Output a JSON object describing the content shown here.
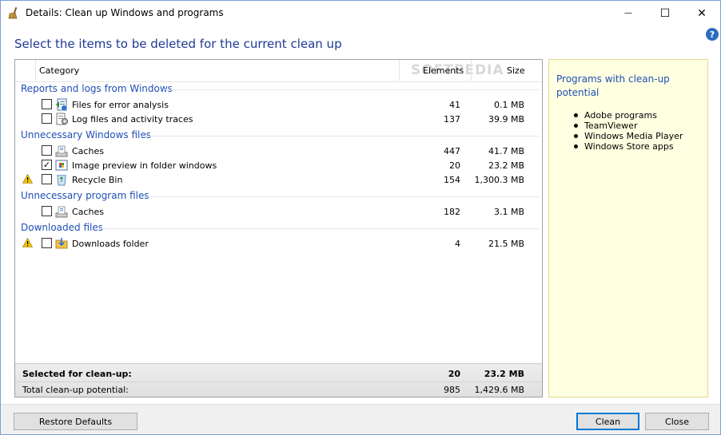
{
  "window": {
    "title": "Details: Clean up Windows and programs",
    "minimize_glyph": "—",
    "maximize_glyph": "☐",
    "close_glyph": "✕",
    "help_glyph": "?"
  },
  "heading": "Select the items to be deleted for the current clean up",
  "columns": {
    "category": "Category",
    "elements": "Elements",
    "size": "Size"
  },
  "watermark": "SOFTPEDIA",
  "groups": [
    {
      "label": "Reports and logs from Windows",
      "items": [
        {
          "label": "Files for error analysis",
          "elements": "41",
          "size": "0.1 MB",
          "checked": false,
          "warning": false,
          "icon": "error-report-icon"
        },
        {
          "label": "Log files and activity traces",
          "elements": "137",
          "size": "39.9 MB",
          "checked": false,
          "warning": false,
          "icon": "log-file-icon"
        }
      ]
    },
    {
      "label": "Unnecessary Windows files",
      "items": [
        {
          "label": "Caches",
          "elements": "447",
          "size": "41.7 MB",
          "checked": false,
          "warning": false,
          "icon": "cache-icon"
        },
        {
          "label": "Image preview in folder windows",
          "elements": "20",
          "size": "23.2 MB",
          "checked": true,
          "warning": false,
          "icon": "image-preview-icon"
        },
        {
          "label": "Recycle Bin",
          "elements": "154",
          "size": "1,300.3 MB",
          "checked": false,
          "warning": true,
          "icon": "recycle-bin-icon"
        }
      ]
    },
    {
      "label": "Unnecessary program files",
      "items": [
        {
          "label": "Caches",
          "elements": "182",
          "size": "3.1 MB",
          "checked": false,
          "warning": false,
          "icon": "cache-icon"
        }
      ]
    },
    {
      "label": "Downloaded files",
      "items": [
        {
          "label": "Downloads folder",
          "elements": "4",
          "size": "21.5 MB",
          "checked": false,
          "warning": true,
          "icon": "downloads-folder-icon"
        }
      ]
    }
  ],
  "summary": {
    "selected_label": "Selected for clean-up:",
    "selected_elements": "20",
    "selected_size": "23.2 MB",
    "total_label": "Total clean-up potential:",
    "total_elements": "985",
    "total_size": "1,429.6 MB"
  },
  "info": {
    "title": "Programs with clean-up potential",
    "programs": [
      "Adobe programs",
      "TeamViewer",
      "Windows Media Player",
      "Windows Store apps"
    ]
  },
  "buttons": {
    "restore": "Restore Defaults",
    "clean": "Clean",
    "close": "Close"
  },
  "colors": {
    "heading": "#1f3a93",
    "group_label": "#1f4fb5",
    "info_background": "#ffffe1",
    "warning": "#f5c400"
  }
}
